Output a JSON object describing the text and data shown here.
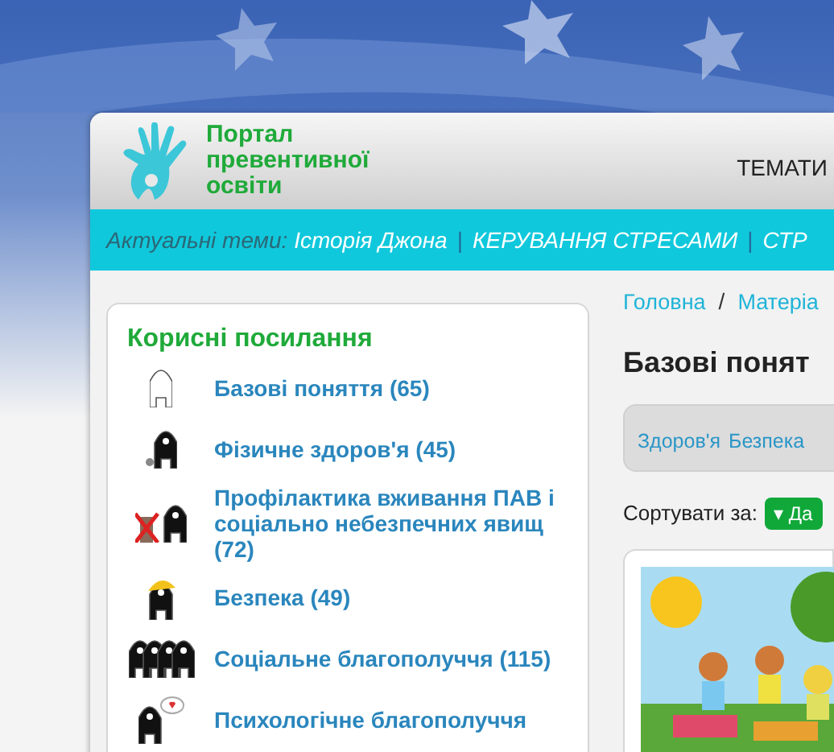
{
  "logo": {
    "lines": [
      "Портал",
      "превентивної",
      "освіти"
    ]
  },
  "top_menu": [
    "ТЕМАТИ"
  ],
  "topics_bar": {
    "label": "Актуальні теми:",
    "links": [
      "Історія Джона",
      "КЕРУВАННЯ СТРЕСАМИ",
      "СТР"
    ],
    "separator": "|"
  },
  "useful_links": {
    "title": "Корисні посилання",
    "items": [
      {
        "label": "Базові поняття (65)"
      },
      {
        "label": "Фізичне здоров'я (45)"
      },
      {
        "label": "Профілактика вживання ПАВ і соціально небезпечних явищ (72)"
      },
      {
        "label": "Безпека (49)"
      },
      {
        "label": "Соціальне благополуччя (115)"
      },
      {
        "label": "Психологічне благополуччя"
      }
    ]
  },
  "breadcrumb": {
    "items": [
      "Головна",
      "Матеріа"
    ],
    "separator": "/"
  },
  "page_title": "Базові понят",
  "filters": [
    "Здоров'я",
    "Безпека"
  ],
  "sort": {
    "label": "Сортувати за:",
    "button": "▾ Да"
  },
  "article": {
    "kind": "picture"
  }
}
